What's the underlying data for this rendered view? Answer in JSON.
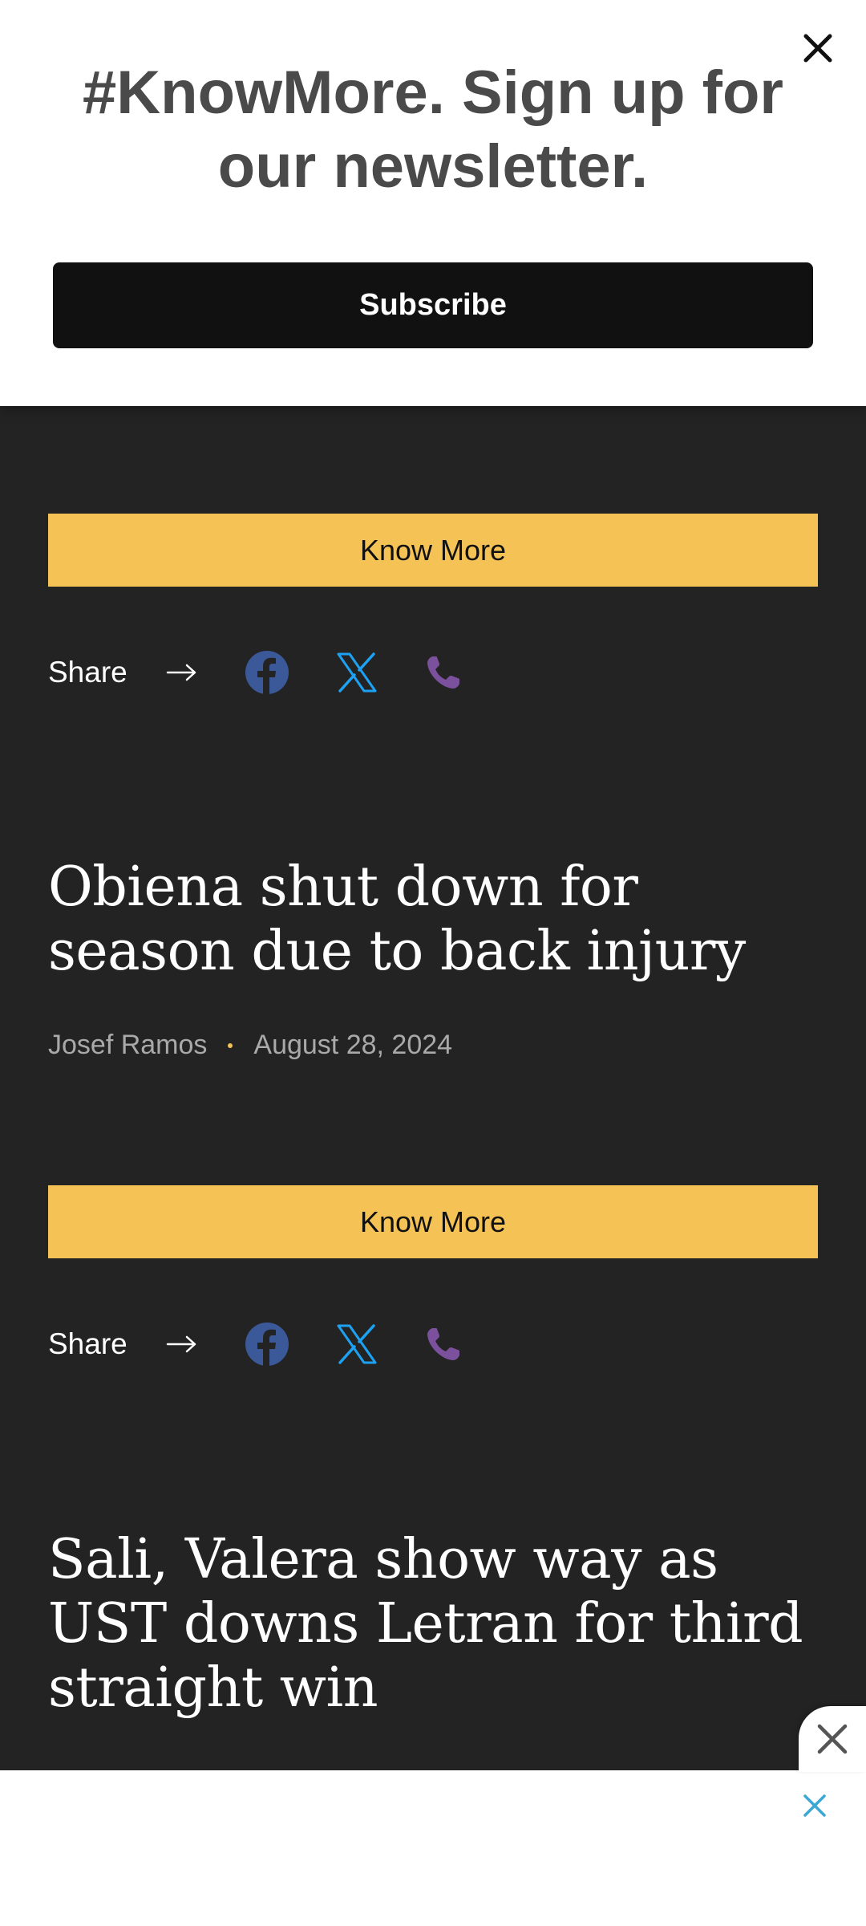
{
  "newsletter": {
    "title": "#KnowMore. Sign up for our newsletter.",
    "subscribe_label": "Subscribe"
  },
  "articles": [
    {
      "know_more_label": "Know More",
      "share_label": "Share"
    },
    {
      "headline": "Obiena shut down for season due to back injury",
      "author": "Josef Ramos",
      "date": "August 28, 2024",
      "know_more_label": "Know More",
      "share_label": "Share"
    },
    {
      "headline": "Sali, Valera show way as UST downs Letran for third straight win"
    }
  ],
  "icons": {
    "close": "close-icon",
    "arrow": "arrow-right-icon",
    "facebook": "facebook-icon",
    "x": "x-icon",
    "phone": "phone-icon"
  },
  "colors": {
    "accent": "#f5c255",
    "background": "#232323",
    "facebook": "#3b5998",
    "x": "#1da1f2",
    "phone": "#7b519d"
  }
}
